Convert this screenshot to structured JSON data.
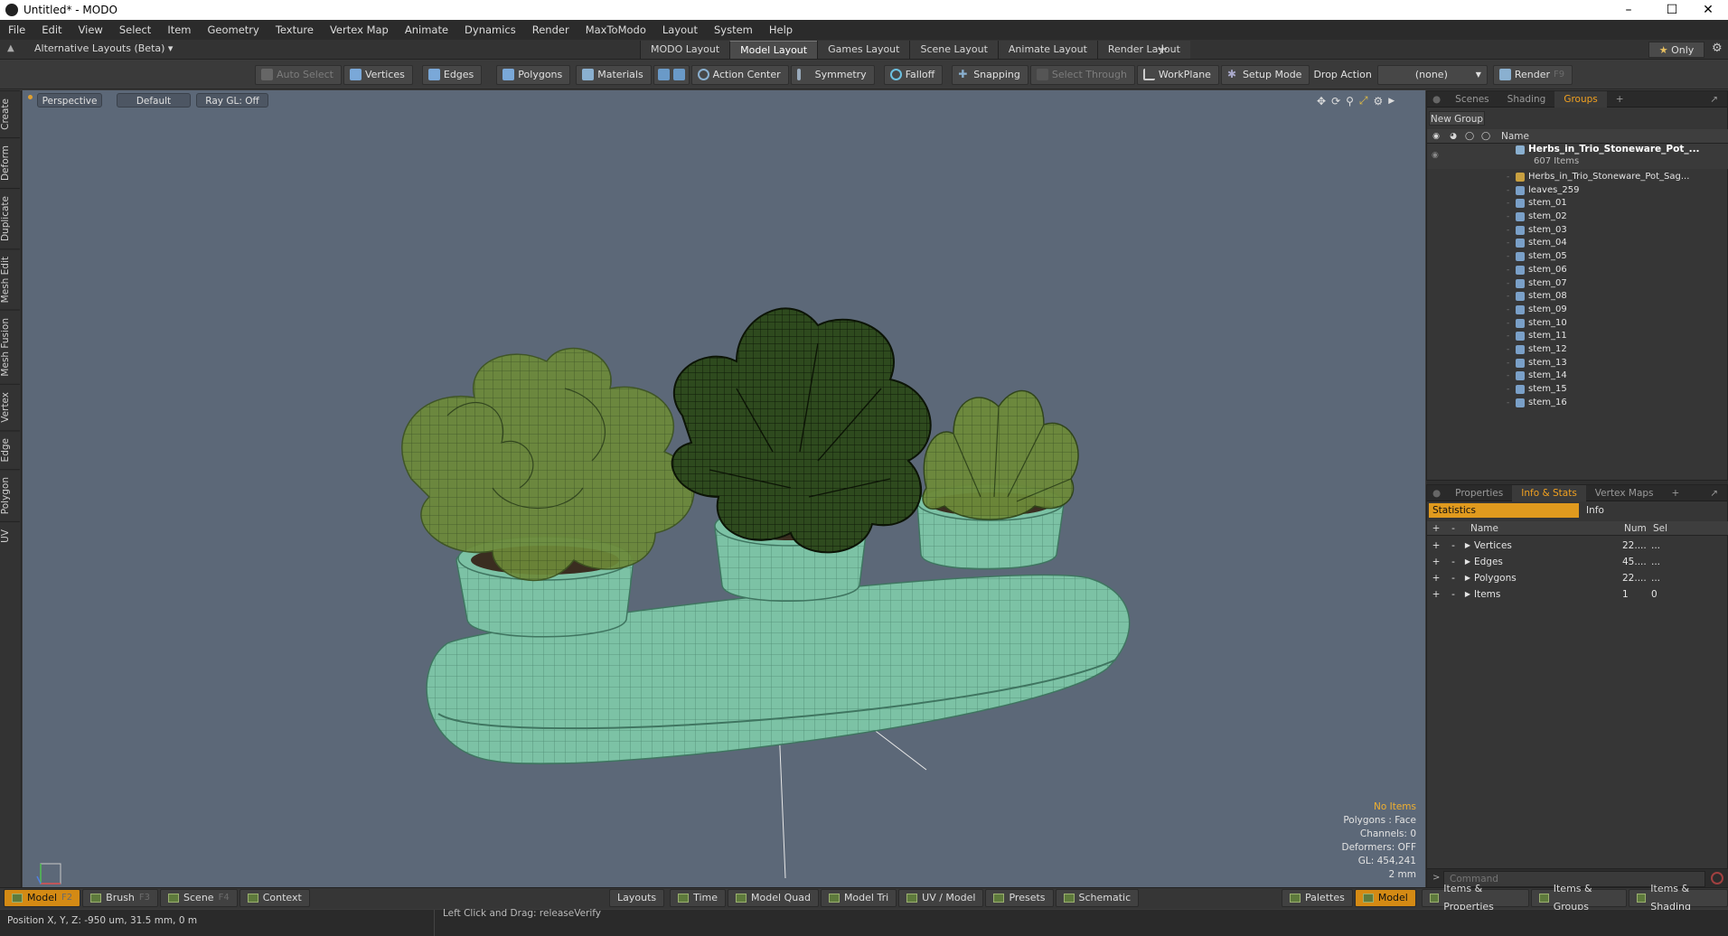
{
  "window": {
    "title": "Untitled* - MODO"
  },
  "menu": [
    "File",
    "Edit",
    "View",
    "Select",
    "Item",
    "Geometry",
    "Texture",
    "Vertex Map",
    "Animate",
    "Dynamics",
    "Render",
    "MaxToModo",
    "Layout",
    "System",
    "Help"
  ],
  "layouts": {
    "selector": "Alternative Layouts (Beta)",
    "tabs": [
      "MODO Layout",
      "Model Layout",
      "Games Layout",
      "Scene Layout",
      "Animate Layout",
      "Render Layout"
    ],
    "active": "Model Layout",
    "add": "+",
    "only_label": "Only"
  },
  "toolbar": {
    "auto_select": "Auto Select",
    "vertices": "Vertices",
    "edges": "Edges",
    "polygons": "Polygons",
    "materials": "Materials",
    "action_center": "Action Center",
    "symmetry": "Symmetry",
    "falloff": "Falloff",
    "snapping": "Snapping",
    "select_through": "Select Through",
    "workplane": "WorkPlane",
    "setup_mode": "Setup Mode",
    "drop_action": "Drop Action",
    "drop_value": "(none)",
    "render": "Render",
    "render_key": "F9"
  },
  "left_tabs": [
    "Create",
    "Deform",
    "Duplicate",
    "Mesh Edit",
    "Mesh Fusion",
    "Vertex",
    "Edge",
    "Polygon",
    "UV"
  ],
  "viewport": {
    "view": "Perspective",
    "shading": "Default",
    "raygl": "Ray GL: Off",
    "hud": {
      "no_items": "No Items",
      "polygons": "Polygons : Face",
      "channels": "Channels: 0",
      "deformers": "Deformers: OFF",
      "gl": "GL: 454,241",
      "scale": "2 mm"
    }
  },
  "groups_panel": {
    "tabs": [
      "Scenes",
      "Shading",
      "Groups"
    ],
    "active": "Groups",
    "new_group": "New Group",
    "name_col": "Name",
    "root_name": "Herbs_in_Trio_Stoneware_Pot_...",
    "root_count": "607 Items",
    "items": [
      "Herbs_in_Trio_Stoneware_Pot_Sag...",
      "leaves_259",
      "stem_01",
      "stem_02",
      "stem_03",
      "stem_04",
      "stem_05",
      "stem_06",
      "stem_07",
      "stem_08",
      "stem_09",
      "stem_10",
      "stem_11",
      "stem_12",
      "stem_13",
      "stem_14",
      "stem_15",
      "stem_16"
    ]
  },
  "props_panel": {
    "tabs": [
      "Properties",
      "Info & Stats",
      "Vertex Maps"
    ],
    "active": "Info & Stats",
    "statistics": "Statistics",
    "info": "Info",
    "col_name": "Name",
    "col_num": "Num",
    "col_sel": "Sel",
    "rows": [
      {
        "name": "Vertices",
        "num": "22....",
        "sel": "..."
      },
      {
        "name": "Edges",
        "num": "45....",
        "sel": "..."
      },
      {
        "name": "Polygons",
        "num": "22....",
        "sel": "..."
      },
      {
        "name": "Items",
        "num": "1",
        "sel": "0"
      }
    ],
    "command_placeholder": "Command"
  },
  "bottom": {
    "left": [
      {
        "label": "Model",
        "key": "F2"
      },
      {
        "label": "Brush",
        "key": "F3"
      },
      {
        "label": "Scene",
        "key": "F4"
      },
      {
        "label": "Context",
        "key": ""
      }
    ],
    "center": [
      "Layouts",
      "Time",
      "Model Quad",
      "Model Tri",
      "UV / Model",
      "Presets",
      "Schematic"
    ],
    "right": [
      "Palettes",
      "Model",
      "Items & Properties",
      "Items & Groups",
      "Items & Shading"
    ]
  },
  "status": {
    "position": "Position X, Y, Z:  -950 um, 31.5 mm, 0 m",
    "hint": "Left Click and Drag:  releaseVerify"
  },
  "colors": {
    "accent": "#f0a020",
    "viewport_bg": "#5c6878",
    "mesh": "#7fc3a6",
    "leaf": "#4f7a2a"
  }
}
